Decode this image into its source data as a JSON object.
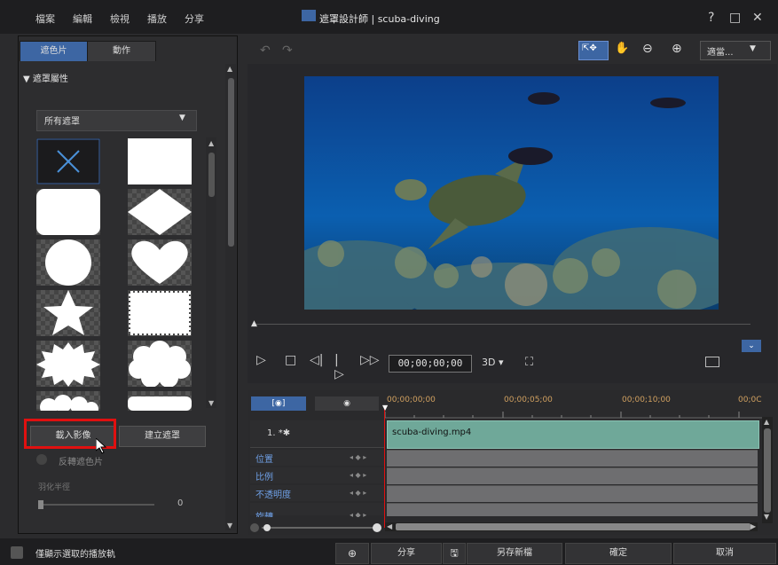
{
  "menu": [
    "檔案",
    "編輯",
    "檢視",
    "播放",
    "分享"
  ],
  "title": "遮罩設計師 | scuba-diving",
  "window_controls": {
    "help": "?",
    "maximize": "□",
    "close": "✕"
  },
  "tabs": {
    "masks": "遮色片",
    "motion": "動作"
  },
  "props_header": "▼ 遮罩屬性",
  "dropdown": {
    "label": "所有遮罩",
    "arrow": "▼"
  },
  "shapes": [
    "none",
    "rectangle",
    "rounded-rectangle",
    "diamond",
    "circle",
    "heart",
    "star",
    "stamp",
    "burst",
    "cloud",
    "cloud-partial",
    "banner-partial"
  ],
  "buttons": {
    "import": "載入影像",
    "create": "建立遮罩"
  },
  "invert_label": "反轉遮色片",
  "feather_label": "羽化半徑",
  "feather_value": "0",
  "toolbar": {
    "undo": "↶",
    "redo": "↷",
    "select": "⇱✥",
    "hand": "✋",
    "zoom_out": "⊖",
    "zoom_in": "⊕",
    "zoom_select": "適當...",
    "zoom_arrow": "▼"
  },
  "transport": {
    "play": "▷",
    "stop": "□",
    "prev": "◁|",
    "next": "|▷",
    "fast": "▷▷",
    "timecode": "00;00;00;00",
    "mode_3d": "3D ▾",
    "expand": "⛶",
    "collapse": "⌄"
  },
  "timeline": {
    "tab1": "[◉]",
    "tab2": "◉",
    "ticks": [
      "00;00;00;00",
      "00;00;05;00",
      "00;00;10;00",
      "00;0C"
    ],
    "track_label": "1. *✱",
    "clip_label": "scuba-diving.mp4",
    "properties": [
      "位置",
      "比例",
      "不透明度",
      "旋轉"
    ],
    "keyframe_controls": "◂ ◆ ▸"
  },
  "bottom": {
    "only_selected": "僅顯示選取的播放軌",
    "share": "分享",
    "save_new": "另存新檔",
    "ok": "確定",
    "cancel": "取消"
  }
}
